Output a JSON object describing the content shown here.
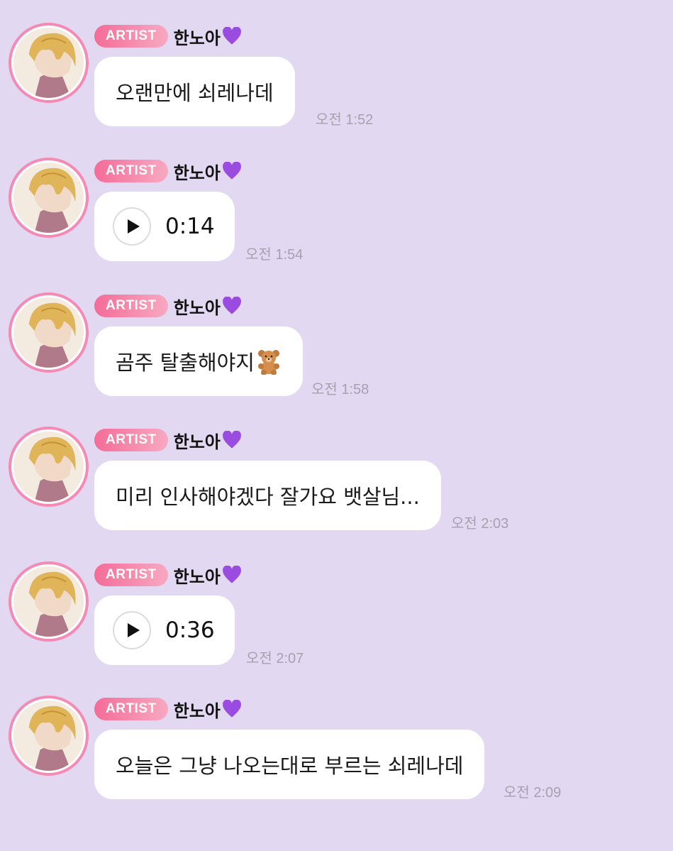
{
  "messages": [
    {
      "badge": "ARTIST",
      "sender": "한노아",
      "type": "text",
      "text": "오랜만에 쇠레나데",
      "time": "오전 1:52"
    },
    {
      "badge": "ARTIST",
      "sender": "한노아",
      "type": "voice",
      "duration": "0:14",
      "time": "오전 1:54"
    },
    {
      "badge": "ARTIST",
      "sender": "한노아",
      "type": "text",
      "text": "곰주 탈출해야지",
      "emoji": "teddy-bear-icon",
      "time": "오전 1:58"
    },
    {
      "badge": "ARTIST",
      "sender": "한노아",
      "type": "text",
      "text": "미리 인사해야겠다 잘가요 뱃살님...",
      "time": "오전 2:03"
    },
    {
      "badge": "ARTIST",
      "sender": "한노아",
      "type": "voice",
      "duration": "0:36",
      "time": "오전 2:07"
    },
    {
      "badge": "ARTIST",
      "sender": "한노아",
      "type": "text",
      "text": "오늘은 그냥 나오는대로 부르는 쇠레나데",
      "time": "오전 2:09"
    }
  ],
  "colors": {
    "background": "#e3d8f1",
    "badge_gradient_start": "#f46c98",
    "badge_gradient_end": "#f7a9c2",
    "avatar_ring": "#f58bb4",
    "bubble": "#ffffff",
    "time_text": "#a7a1ae",
    "heart": "#9b4ce0"
  }
}
